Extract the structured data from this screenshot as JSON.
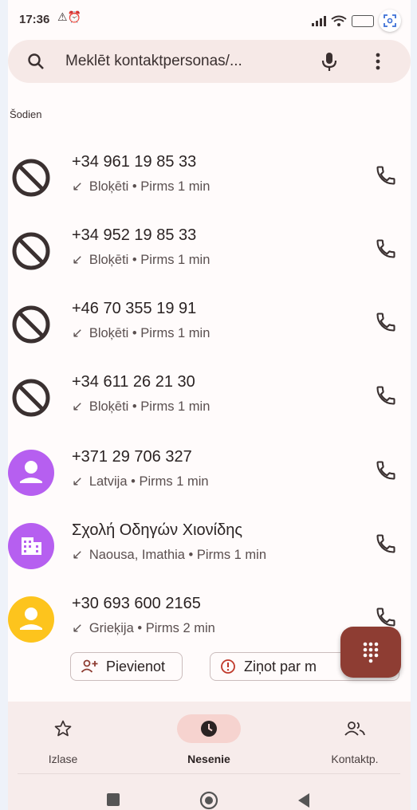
{
  "status_bar": {
    "time": "17:36",
    "icons": "⚠⏰"
  },
  "search": {
    "placeholder": "Meklēt kontaktpersonas/..."
  },
  "section": {
    "label": "Šodien"
  },
  "calls": [
    {
      "name": "+34 961 19 85 33",
      "detail": "Bloķēti • Pirms 1 min",
      "avatar": "blocked-icon"
    },
    {
      "name": "+34 952 19 85 33",
      "detail": "Bloķēti • Pirms 1 min",
      "avatar": "blocked-icon"
    },
    {
      "name": "+46 70 355 19 91",
      "detail": "Bloķēti • Pirms 1 min",
      "avatar": "blocked-icon"
    },
    {
      "name": "+34 611 26 21 30",
      "detail": "Bloķēti • Pirms 1 min",
      "avatar": "blocked-icon"
    },
    {
      "name": "+371 29 706 327",
      "detail": "Latvija • Pirms 1 min",
      "avatar": "person-avatar-icon"
    },
    {
      "name": "Σχολή Οδηγών Χιονίδης",
      "detail": "Naousa, Imathia • Pirms 1 min",
      "avatar": "business-avatar-icon"
    },
    {
      "name": "+30 693 600 2165",
      "detail": "Grieķija • Pirms 2 min",
      "avatar": "person-avatar-icon"
    }
  ],
  "actions": {
    "add_label": "Pievienot",
    "report_label": "Ziņot par m"
  },
  "nav": {
    "favorites": "Izlase",
    "recents": "Nesenie",
    "contacts": "Kontaktp."
  },
  "colors": {
    "accent": "#8e3d33",
    "active_nav_bg": "#f6d3cf",
    "purple_avatar": "#b65ff0",
    "yellow_avatar": "#fdc41d"
  }
}
